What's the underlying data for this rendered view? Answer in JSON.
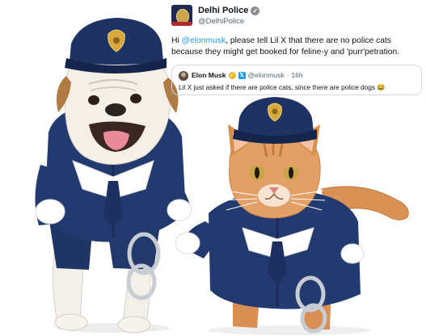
{
  "tweet": {
    "author_name": "Delhi Police",
    "author_handle": "@DelhiPolice",
    "verified_icon": "check",
    "body": {
      "prefix": "Hi ",
      "mention": "@elonmusk",
      "suffix": ", please tell Lil X that there are no police cats because they might get booked for feline-y and 'purr'petration."
    }
  },
  "quote": {
    "author_name": "Elon Musk",
    "badge_x": "𝕏",
    "author_handle": "@elonmusk",
    "separator": "·",
    "time": "16h",
    "text": "Lil X just asked if there are police cats, since there are police dogs 😂"
  },
  "photos": {
    "left": "bulldog-in-police-costume",
    "right": "orange-cat-in-police-costume"
  },
  "colors": {
    "mention": "#1d9bf0",
    "uniform": "#1f3566",
    "handcuffs": "#c8cdd3"
  }
}
